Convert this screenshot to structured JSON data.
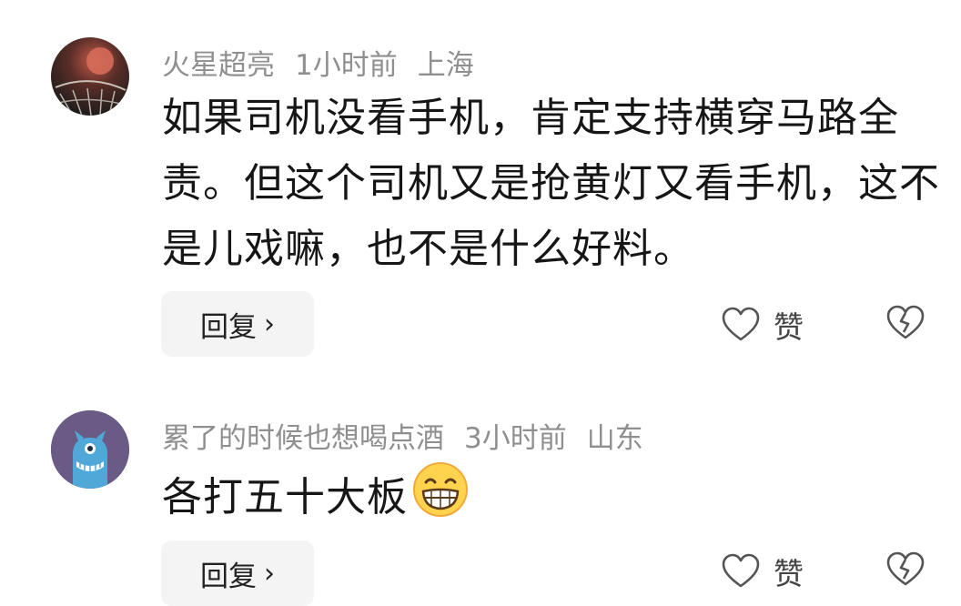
{
  "comments": [
    {
      "username": "火星超亮",
      "time": "1小时前",
      "location": "上海",
      "text": "如果司机没看手机，肯定支持横穿马路全责。但这个司机又是抢黄灯又看手机，这不是儿戏嘛，也不是什么好料。",
      "reply_label": "回复",
      "like_label": "赞",
      "avatar_icon": "basketball-avatar-icon"
    },
    {
      "username": "累了的时候也想喝点酒",
      "time": "3小时前",
      "location": "山东",
      "text": "各打五十大板",
      "emoji": "grinning-face-emoji",
      "reply_label": "回复",
      "like_label": "赞",
      "avatar_icon": "monster-avatar-icon"
    }
  ],
  "colors": {
    "meta": "#8f8f8f",
    "text": "#161616",
    "button_bg": "#f4f4f4",
    "avatar2_bg": "#6a5a86",
    "monster": "#4fa8d8"
  }
}
